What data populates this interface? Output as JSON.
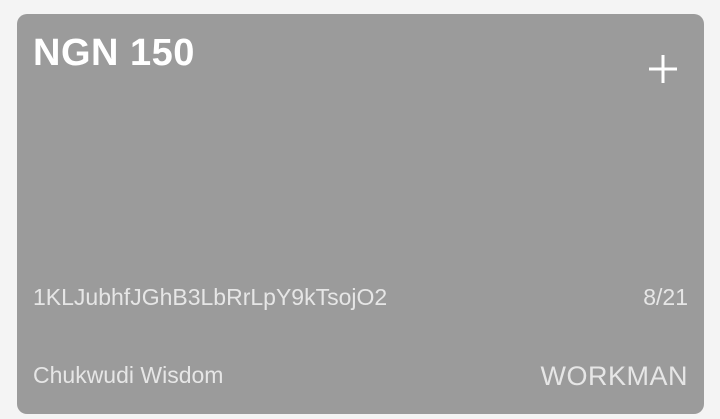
{
  "card": {
    "amount": "NGN 150",
    "code": "1KLJubhfJGhB3LbRrLpY9kTsojO2",
    "counter": "8/21",
    "holder_name": "Chukwudi Wisdom",
    "role": "WORKMAN",
    "add_icon": "plus-icon",
    "background_color": "#9b9b9b",
    "text_color": "#ffffff"
  }
}
